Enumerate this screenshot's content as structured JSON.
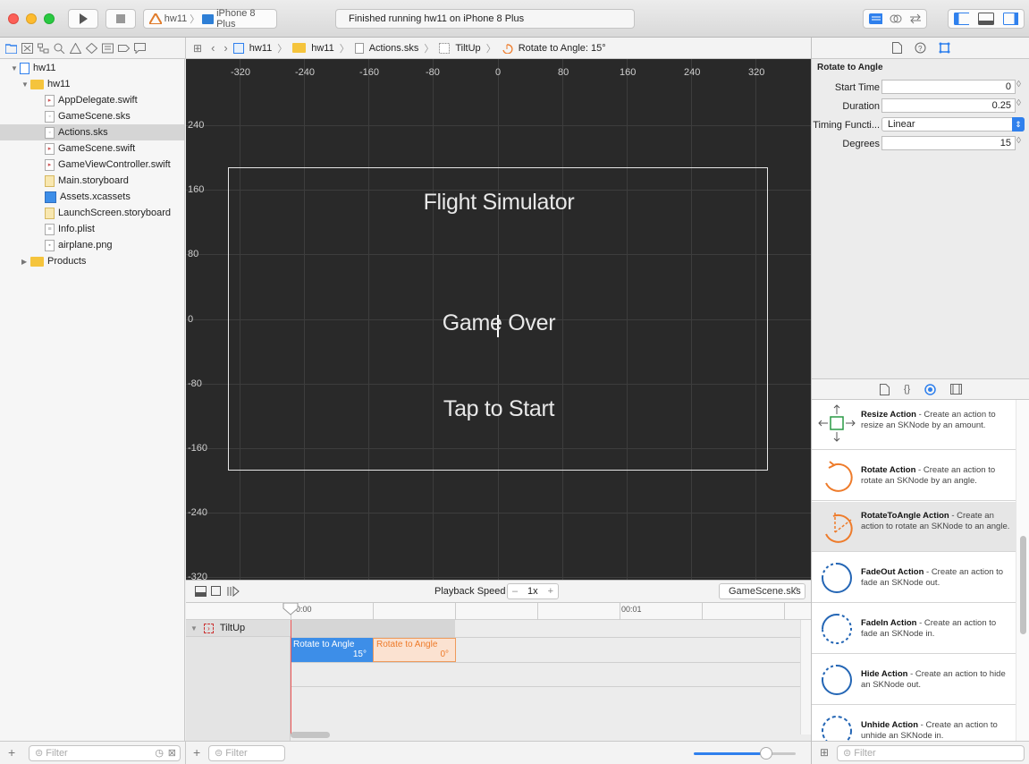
{
  "toolbar": {
    "scheme": "hw11",
    "device": "iPhone 8 Plus",
    "status": "Finished running hw11 on iPhone 8 Plus"
  },
  "jumpbar": {
    "items": [
      "hw11",
      "hw11",
      "Actions.sks",
      "TiltUp",
      "Rotate to Angle: 15°"
    ]
  },
  "navigator": {
    "project": "hw11",
    "group": "hw11",
    "files": [
      "AppDelegate.swift",
      "GameScene.sks",
      "Actions.sks",
      "GameScene.swift",
      "GameViewController.swift",
      "Main.storyboard",
      "Assets.xcassets",
      "LaunchScreen.storyboard",
      "Info.plist",
      "airplane.png"
    ],
    "selected_file": "Actions.sks",
    "products": "Products",
    "filter_placeholder": "Filter"
  },
  "scene": {
    "x_ticks": [
      "-320",
      "-240",
      "-160",
      "-80",
      "0",
      "80",
      "160",
      "240",
      "320"
    ],
    "y_ticks": [
      "240",
      "160",
      "80",
      "0",
      "-80",
      "-160",
      "-240",
      "-320"
    ],
    "labels": {
      "title": "Flight Simulator",
      "game_over": "Game Over",
      "tap": "Tap to Start"
    }
  },
  "timeline": {
    "playback_label": "Playback Speed",
    "speed": "1x",
    "minus": "–",
    "plus": "+",
    "scene_select": "GameScene.sks",
    "time_start": "0:00",
    "time_mark": "00:01",
    "track": "TiltUp",
    "actions": [
      {
        "name": "Rotate to Angle",
        "value": "15°"
      },
      {
        "name": "Rotate to Angle",
        "value": "0°"
      }
    ],
    "filter_placeholder": "Filter"
  },
  "inspector": {
    "section": "Rotate to Angle",
    "fields": [
      {
        "label": "Start Time",
        "value": "0"
      },
      {
        "label": "Duration",
        "value": "0.25"
      },
      {
        "label": "Timing Functi...",
        "value": "Linear"
      },
      {
        "label": "Degrees",
        "value": "15"
      }
    ]
  },
  "library": {
    "items": [
      {
        "name": "Resize Action",
        "desc": " - Create an action to resize an SKNode by an amount."
      },
      {
        "name": "Rotate Action",
        "desc": " - Create an action to rotate an SKNode by an angle."
      },
      {
        "name": "RotateToAngle Action",
        "desc": " - Create an action to rotate an SKNode to an angle."
      },
      {
        "name": "FadeOut Action",
        "desc": " - Create an action to fade an SKNode out."
      },
      {
        "name": "FadeIn Action",
        "desc": " - Create an action to fade an SKNode in."
      },
      {
        "name": "Hide Action",
        "desc": " - Create an action to hide an SKNode out."
      },
      {
        "name": "Unhide Action",
        "desc": " - Create an action to unhide an SKNode in."
      }
    ],
    "filter_placeholder": "Filter"
  },
  "colors": {
    "accent": "#2f80ed",
    "action_orange": "#ee7b2a",
    "timeline_blue": "#3d8ee8"
  }
}
